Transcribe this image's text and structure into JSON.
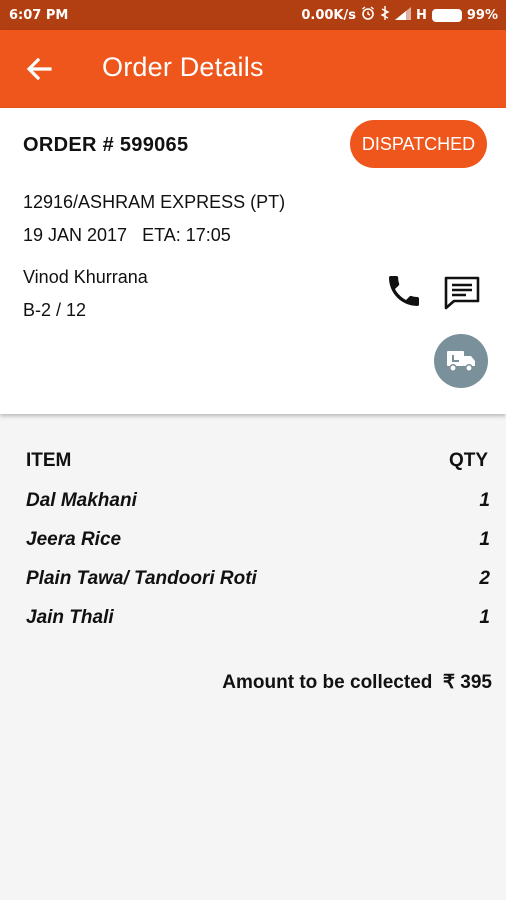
{
  "status_bar": {
    "time": "6:07 PM",
    "speed": "0.00K/s",
    "network": "H",
    "battery": "99%"
  },
  "app_bar": {
    "title": "Order Details"
  },
  "order": {
    "number_label": "ORDER # 599065",
    "status": "DISPATCHED",
    "train": "12916/ASHRAM EXPRESS (PT)",
    "date_eta": "19 JAN 2017   ETA: 17:05",
    "customer_name": "Vinod Khurrana",
    "seat": "B-2 / 12"
  },
  "items": {
    "header_item": "ITEM",
    "header_qty": "QTY",
    "rows": [
      {
        "name": "Dal Makhani",
        "qty": "1"
      },
      {
        "name": "Jeera Rice",
        "qty": "1"
      },
      {
        "name": "Plain Tawa/ Tandoori Roti",
        "qty": "2"
      },
      {
        "name": "Jain Thali",
        "qty": "1"
      }
    ]
  },
  "amount": {
    "label": "Amount to be collected  ₹ 395"
  },
  "colors": {
    "accent": "#ef561c",
    "status_bar": "#b23f11",
    "truck_button": "#7a909b"
  }
}
